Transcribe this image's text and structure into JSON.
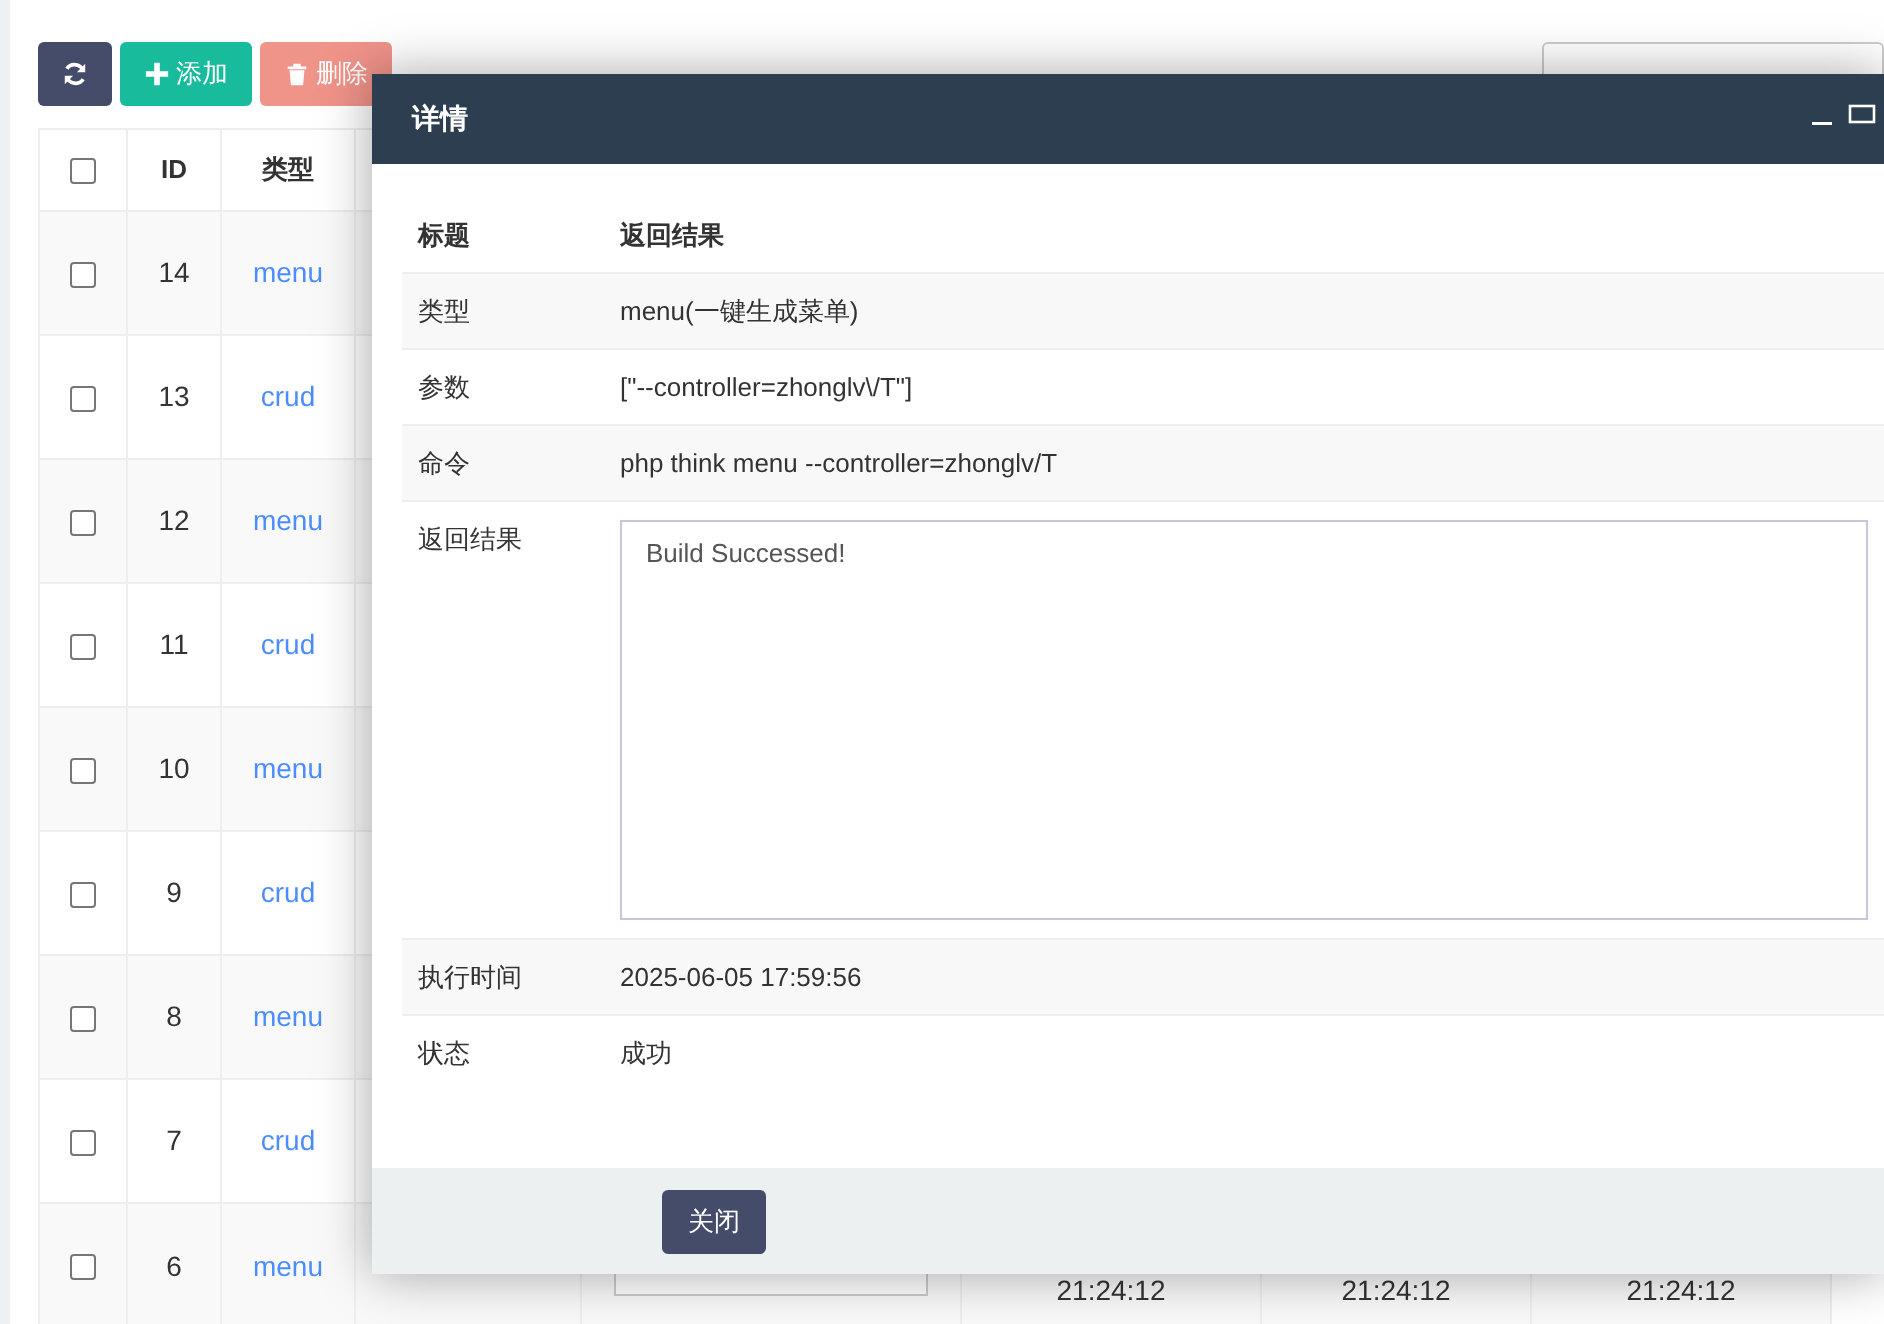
{
  "toolbar": {
    "buttons": [
      {
        "kind": "refresh",
        "disabled": false
      },
      {
        "kind": "add",
        "label": "添加",
        "disabled": false
      },
      {
        "kind": "delete",
        "label": "删除",
        "disabled": true
      }
    ]
  },
  "table": {
    "header": {
      "checked": false,
      "columns": [
        "ID",
        "类型"
      ]
    },
    "rows": [
      {
        "checked": false,
        "id": "14",
        "type": "menu"
      },
      {
        "checked": false,
        "id": "13",
        "type": "crud"
      },
      {
        "checked": false,
        "id": "12",
        "type": "menu"
      },
      {
        "checked": false,
        "id": "11",
        "type": "crud"
      },
      {
        "checked": false,
        "id": "10",
        "type": "menu"
      },
      {
        "checked": false,
        "id": "9",
        "type": "crud"
      },
      {
        "checked": false,
        "id": "8",
        "type": "menu"
      },
      {
        "checked": false,
        "id": "7",
        "type": "crud"
      },
      {
        "checked": false,
        "id": "6",
        "type": "menu",
        "times": [
          "21:24:12",
          "21:24:12",
          "21:24:12"
        ]
      }
    ]
  },
  "dialog": {
    "title": "详情",
    "header": {
      "label": "标题",
      "value": "返回结果"
    },
    "rows": [
      {
        "kind": "text",
        "label": "类型",
        "value": "menu(一键生成菜单)"
      },
      {
        "kind": "text",
        "label": "参数",
        "value": "[\"--controller=zhonglv\\/T\"]"
      },
      {
        "kind": "text",
        "label": "命令",
        "value": "php think menu --controller=zhonglv/T"
      },
      {
        "kind": "textarea",
        "label": "返回结果",
        "value": "Build Successed!"
      },
      {
        "kind": "text",
        "label": "执行时间",
        "value": "2025-06-05 17:59:56"
      },
      {
        "kind": "text",
        "label": "状态",
        "value": "成功"
      }
    ],
    "close_button": "关闭"
  }
}
